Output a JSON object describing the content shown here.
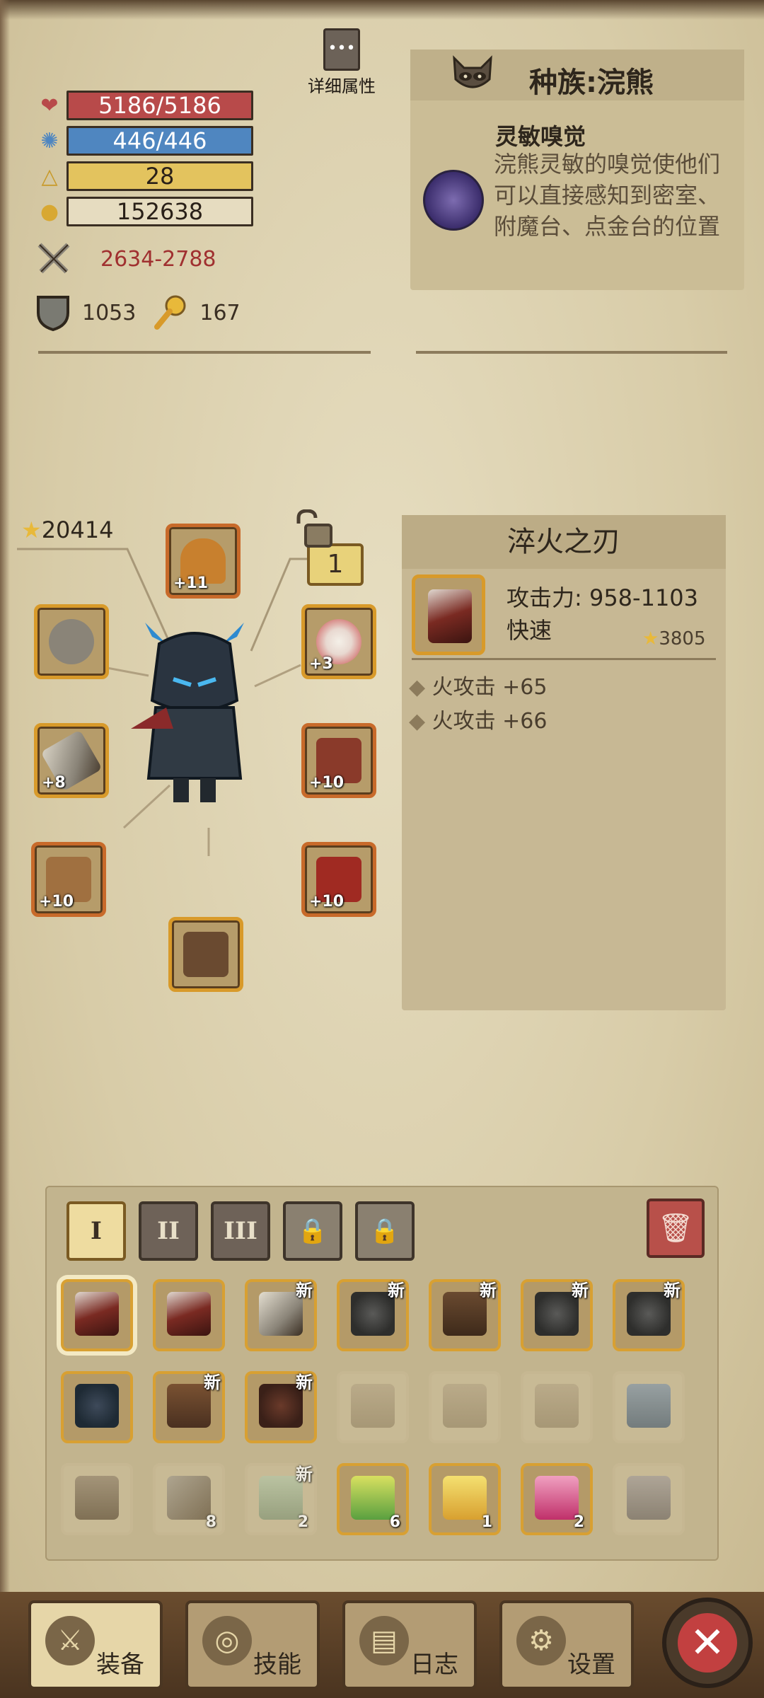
{
  "detail_button": {
    "label": "详细属性"
  },
  "stats": {
    "hp": "5186/5186",
    "mp": "446/446",
    "level": "28",
    "gold": "152638",
    "damage": "2634-2788",
    "armor": "1053",
    "secondary": "167"
  },
  "race": {
    "title": "种族:浣熊",
    "trait_name": "灵敏嗅觉",
    "trait_desc": "浣熊灵敏的嗅觉使他们可以直接感知到密室、附魔台、点金台的位置"
  },
  "equipment": {
    "score": "20414",
    "level_badge": "1",
    "slots": [
      {
        "name": "helmet",
        "plus": "+11"
      },
      {
        "name": "ring",
        "plus": ""
      },
      {
        "name": "amulet",
        "plus": "+3"
      },
      {
        "name": "weapon",
        "plus": "+8"
      },
      {
        "name": "armor",
        "plus": "+10"
      },
      {
        "name": "gloves",
        "plus": "+10"
      },
      {
        "name": "cloak",
        "plus": "+10"
      },
      {
        "name": "boots",
        "plus": ""
      }
    ]
  },
  "item_info": {
    "title": "淬火之刃",
    "attack": "攻击力: 958-1103",
    "speed": "快速",
    "score": "3805",
    "props": [
      "火攻击 +65",
      "火攻击 +66"
    ]
  },
  "inventory": {
    "tabs": [
      "I",
      "II",
      "III"
    ],
    "rows": [
      [
        {
          "type": "blade",
          "new": "",
          "count": "",
          "selected": true
        },
        {
          "type": "blade",
          "new": "",
          "count": ""
        },
        {
          "type": "sword",
          "new": "新",
          "count": ""
        },
        {
          "type": "helm",
          "new": "新",
          "count": ""
        },
        {
          "type": "belt",
          "new": "新",
          "count": ""
        },
        {
          "type": "helm",
          "new": "新",
          "count": ""
        },
        {
          "type": "helm",
          "new": "新",
          "count": ""
        }
      ],
      [
        {
          "type": "armor",
          "new": "",
          "count": ""
        },
        {
          "type": "boots",
          "new": "新",
          "count": ""
        },
        {
          "type": "whip",
          "new": "新",
          "count": ""
        },
        {
          "type": "box",
          "new": "",
          "count": "",
          "empty": true
        },
        {
          "type": "box",
          "new": "",
          "count": "",
          "empty": true
        },
        {
          "type": "box",
          "new": "",
          "count": "",
          "empty": true
        },
        {
          "type": "claw",
          "new": "",
          "count": "",
          "empty": true
        }
      ],
      [
        {
          "type": "shield",
          "new": "",
          "count": "",
          "empty": true
        },
        {
          "type": "pickaxe",
          "new": "",
          "count": "8",
          "empty": true
        },
        {
          "type": "map",
          "new": "新",
          "count": "2",
          "empty": true
        },
        {
          "type": "potion-green",
          "new": "",
          "count": "6"
        },
        {
          "type": "potion-yellow",
          "new": "",
          "count": "1"
        },
        {
          "type": "potion-pink",
          "new": "",
          "count": "2"
        },
        {
          "type": "rock",
          "new": "",
          "count": "",
          "empty": true
        }
      ]
    ]
  },
  "nav": {
    "equip": "装备",
    "skills": "技能",
    "log": "日志",
    "settings": "设置"
  },
  "colors": {
    "hp": "#b84a4a",
    "mp": "#4f86c0",
    "level": "#e3c35e",
    "slot_border": "#d89a2a",
    "damage_text": "#a03030"
  }
}
